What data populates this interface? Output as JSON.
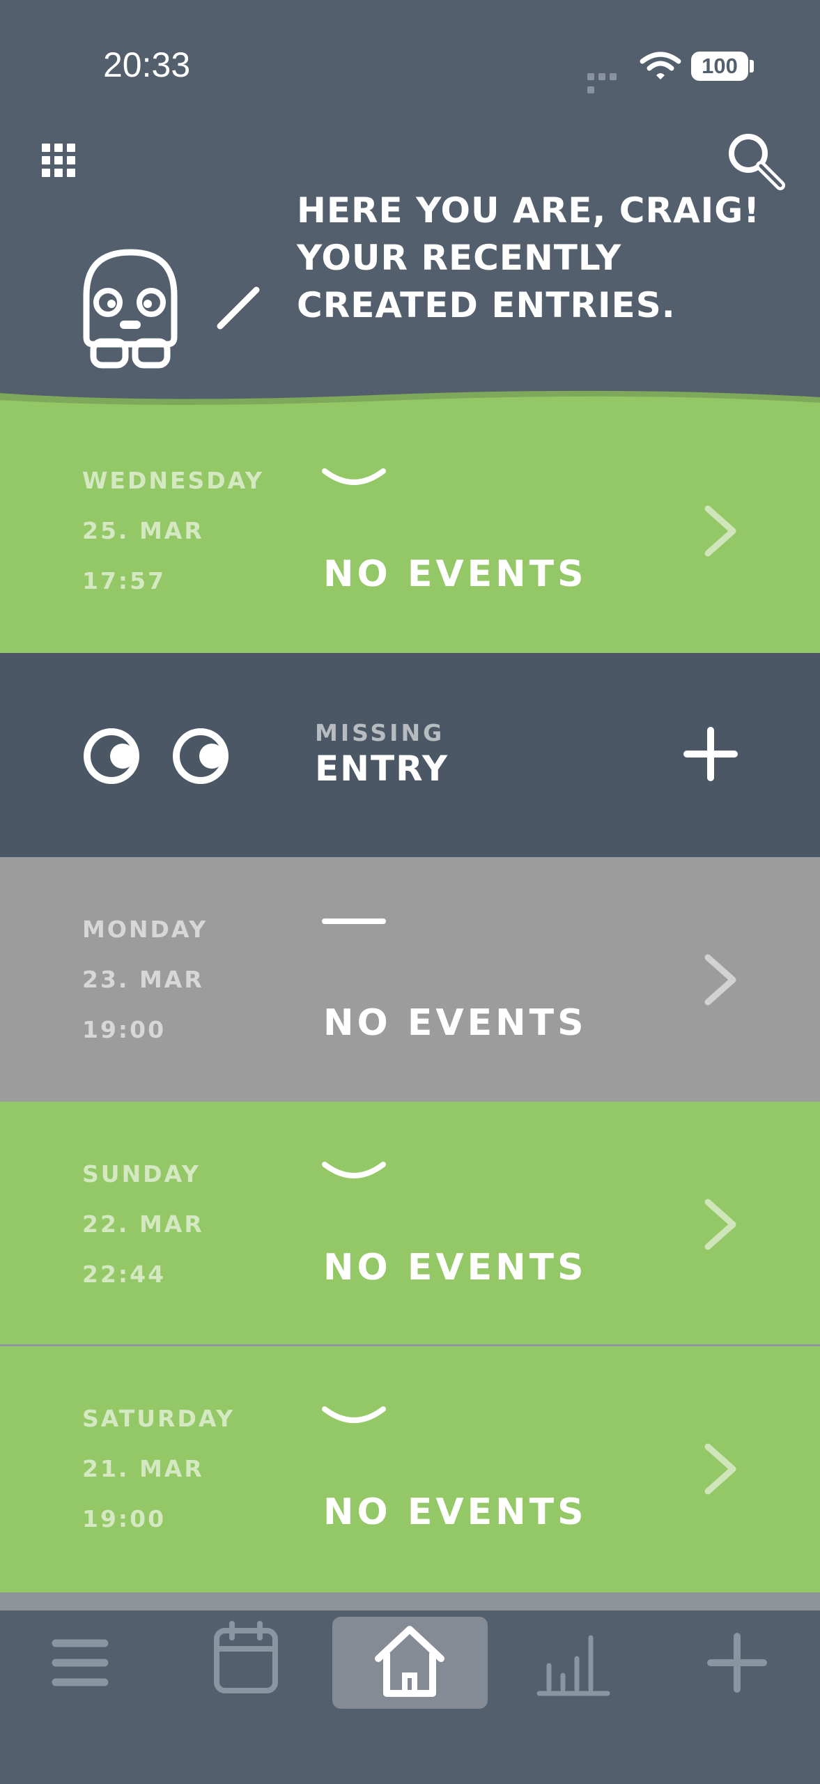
{
  "status": {
    "time": "20:33",
    "battery": "100"
  },
  "header": {
    "greeting": "HERE YOU ARE, CRAIG! YOUR RECENTLY CREATED ENTRIES."
  },
  "entries": [
    {
      "day": "WEDNESDAY",
      "date": "25. MAR",
      "time": "17:57",
      "events": "NO EVENTS",
      "mood": "happy",
      "color": "#94c766"
    },
    {
      "day": "MONDAY",
      "date": "23. MAR",
      "time": "19:00",
      "events": "NO EVENTS",
      "mood": "neutral",
      "color": "#9c9c9c"
    },
    {
      "day": "SUNDAY",
      "date": "22. MAR",
      "time": "22:44",
      "events": "NO EVENTS",
      "mood": "happy",
      "color": "#94c766"
    },
    {
      "day": "SATURDAY",
      "date": "21. MAR",
      "time": "19:00",
      "events": "NO EVENTS",
      "mood": "happy",
      "color": "#94c766"
    }
  ],
  "missing": {
    "small": "MISSING",
    "big": "ENTRY"
  },
  "tabs": [
    {
      "icon": "menu-icon"
    },
    {
      "icon": "calendar-icon"
    },
    {
      "icon": "home-icon",
      "active": true
    },
    {
      "icon": "stats-icon"
    },
    {
      "icon": "plus-icon"
    }
  ],
  "colors": {
    "header": "#535f6d",
    "green": "#94c766",
    "gray": "#9c9c9c",
    "missing": "#4b5764"
  }
}
